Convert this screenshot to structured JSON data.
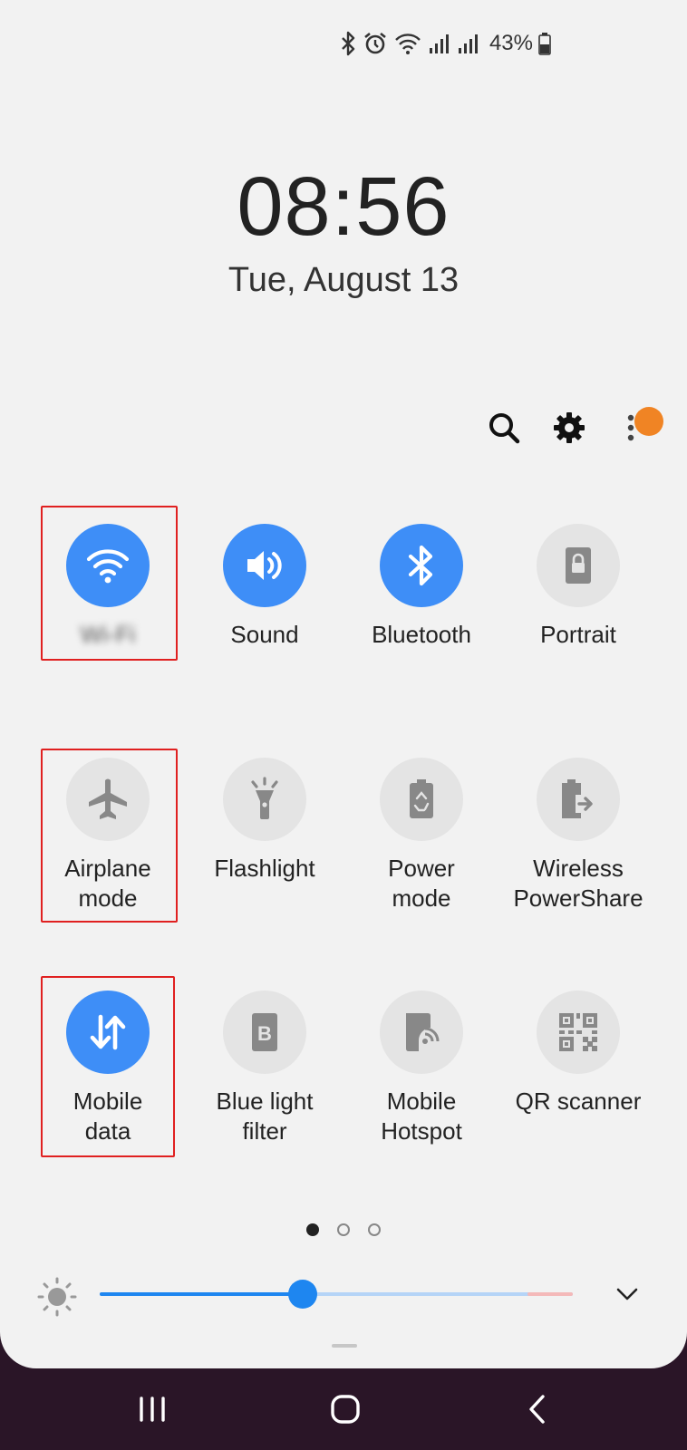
{
  "status_bar": {
    "icons": [
      "bluetooth-icon",
      "alarm-icon",
      "wifi-icon",
      "signal-icon",
      "signal-icon"
    ],
    "battery_percent": "43%"
  },
  "lockscreen": {
    "time": "08:56",
    "date": "Tue, August 13"
  },
  "top_actions": [
    "search-icon",
    "settings-icon",
    "more-options-icon"
  ],
  "tiles": [
    {
      "label": "Wi-Fi",
      "icon": "wifi-icon",
      "state": "on"
    },
    {
      "label": "Sound",
      "icon": "sound-icon",
      "state": "on"
    },
    {
      "label": "Bluetooth",
      "icon": "bluetooth-icon",
      "state": "on"
    },
    {
      "label": "Portrait",
      "icon": "portrait-lock-icon",
      "state": "off"
    },
    {
      "label": "Airplane\nmode",
      "icon": "airplane-icon",
      "state": "off"
    },
    {
      "label": "Flashlight",
      "icon": "flashlight-icon",
      "state": "off"
    },
    {
      "label": "Power\nmode",
      "icon": "power-mode-icon",
      "state": "off"
    },
    {
      "label": "Wireless\nPowerShare",
      "icon": "wireless-powershare-icon",
      "state": "off"
    },
    {
      "label": "Mobile\ndata",
      "icon": "mobile-data-icon",
      "state": "on"
    },
    {
      "label": "Blue light\nfilter",
      "icon": "blue-light-filter-icon",
      "state": "off"
    },
    {
      "label": "Mobile\nHotspot",
      "icon": "mobile-hotspot-icon",
      "state": "off"
    },
    {
      "label": "QR scanner",
      "icon": "qr-scanner-icon",
      "state": "off"
    }
  ],
  "pagination": {
    "pages": 3,
    "current": 1
  },
  "brightness": {
    "level": 0.43
  },
  "navigation": [
    "recent-apps-icon",
    "home-icon",
    "back-icon"
  ],
  "colors": {
    "accent": "#3e8ef7",
    "tile_off": "#e4e4e4",
    "highlight": "#e02020",
    "nav_bg": "#2a1527"
  }
}
